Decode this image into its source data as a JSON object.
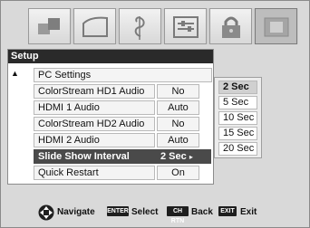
{
  "tabs": [
    {
      "icon": "picture-icon",
      "active": false
    },
    {
      "icon": "screen-shape-icon",
      "active": false
    },
    {
      "icon": "music-note-icon",
      "active": false
    },
    {
      "icon": "preferences-icon",
      "active": false
    },
    {
      "icon": "lock-icon",
      "active": false
    },
    {
      "icon": "setup-icon",
      "active": true
    }
  ],
  "menu": {
    "title": "Setup",
    "scroll_indicator": "▲",
    "rows": [
      {
        "label": "PC Settings",
        "value": null
      },
      {
        "label": "ColorStream HD1 Audio",
        "value": "No"
      },
      {
        "label": "HDMI 1 Audio",
        "value": "Auto"
      },
      {
        "label": "ColorStream HD2 Audio",
        "value": "No"
      },
      {
        "label": "HDMI 2 Audio",
        "value": "Auto"
      },
      {
        "label": "Slide Show Interval",
        "value": "2 Sec",
        "arrow": "▸",
        "highlighted": true
      },
      {
        "label": "Quick Restart",
        "value": "On"
      }
    ]
  },
  "submenu": {
    "options": [
      "2 Sec",
      "5 Sec",
      "10 Sec",
      "15 Sec",
      "20 Sec"
    ],
    "selected": "2 Sec"
  },
  "footer": {
    "navigate": "Navigate",
    "enter_key": "ENTER",
    "select": "Select",
    "chrtn_key": "CH RTN",
    "back": "Back",
    "exit_key": "EXIT",
    "exit": "Exit"
  }
}
